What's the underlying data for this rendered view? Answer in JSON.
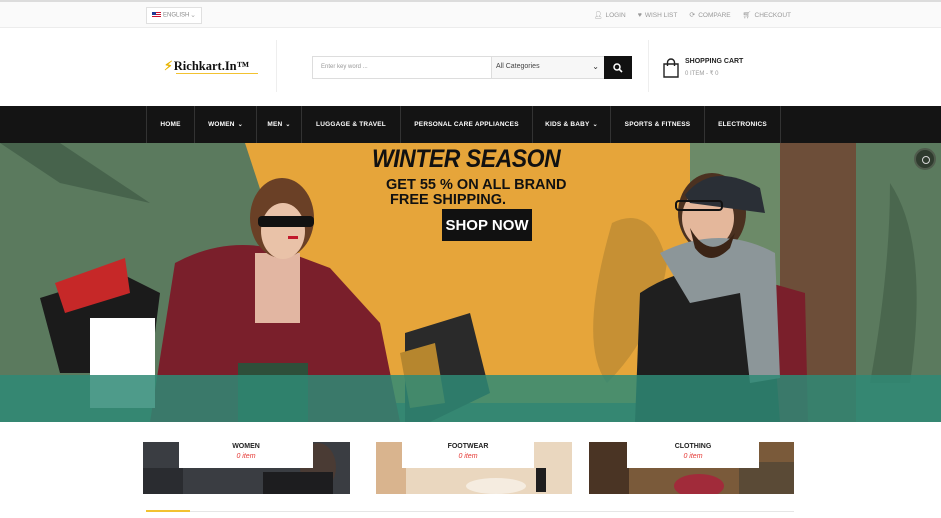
{
  "topbar": {
    "language": "ENGLISH",
    "links": [
      "LOGIN",
      "WISH LIST",
      "COMPARE",
      "CHECKOUT"
    ]
  },
  "header": {
    "logo": "Richkart.In™",
    "search_placeholder": "Enter key word ...",
    "category_selected": "All Categories",
    "cart_title": "SHOPPING CART",
    "cart_summary": "0 ITEM - ₹ 0"
  },
  "nav": {
    "items": [
      {
        "label": "HOME"
      },
      {
        "label": "WOMEN"
      },
      {
        "label": "MEN"
      },
      {
        "label": "LUGGAGE & TRAVEL"
      },
      {
        "label": "PERSONAL CARE APPLIANCES"
      },
      {
        "label": "KIDS & BABY"
      },
      {
        "label": "SPORTS & FITNESS"
      },
      {
        "label": "ELECTRONICS"
      }
    ]
  },
  "hero": {
    "title": "WINTER SEASON",
    "line1": "GET 55 % ON ALL BRAND",
    "line2": "FREE SHIPPING.",
    "cta": "SHOP NOW"
  },
  "categories": [
    {
      "name": "WOMEN",
      "count": "0 item"
    },
    {
      "name": "FOOTWEAR",
      "count": "0 item"
    },
    {
      "name": "CLOTHING",
      "count": "0 item"
    }
  ],
  "colors": {
    "accent": "#f2c230",
    "nav_bg": "#141414",
    "hero_orange": "#e6a53a",
    "hero_green": "#5b7a5e",
    "count_red": "#e53935"
  }
}
